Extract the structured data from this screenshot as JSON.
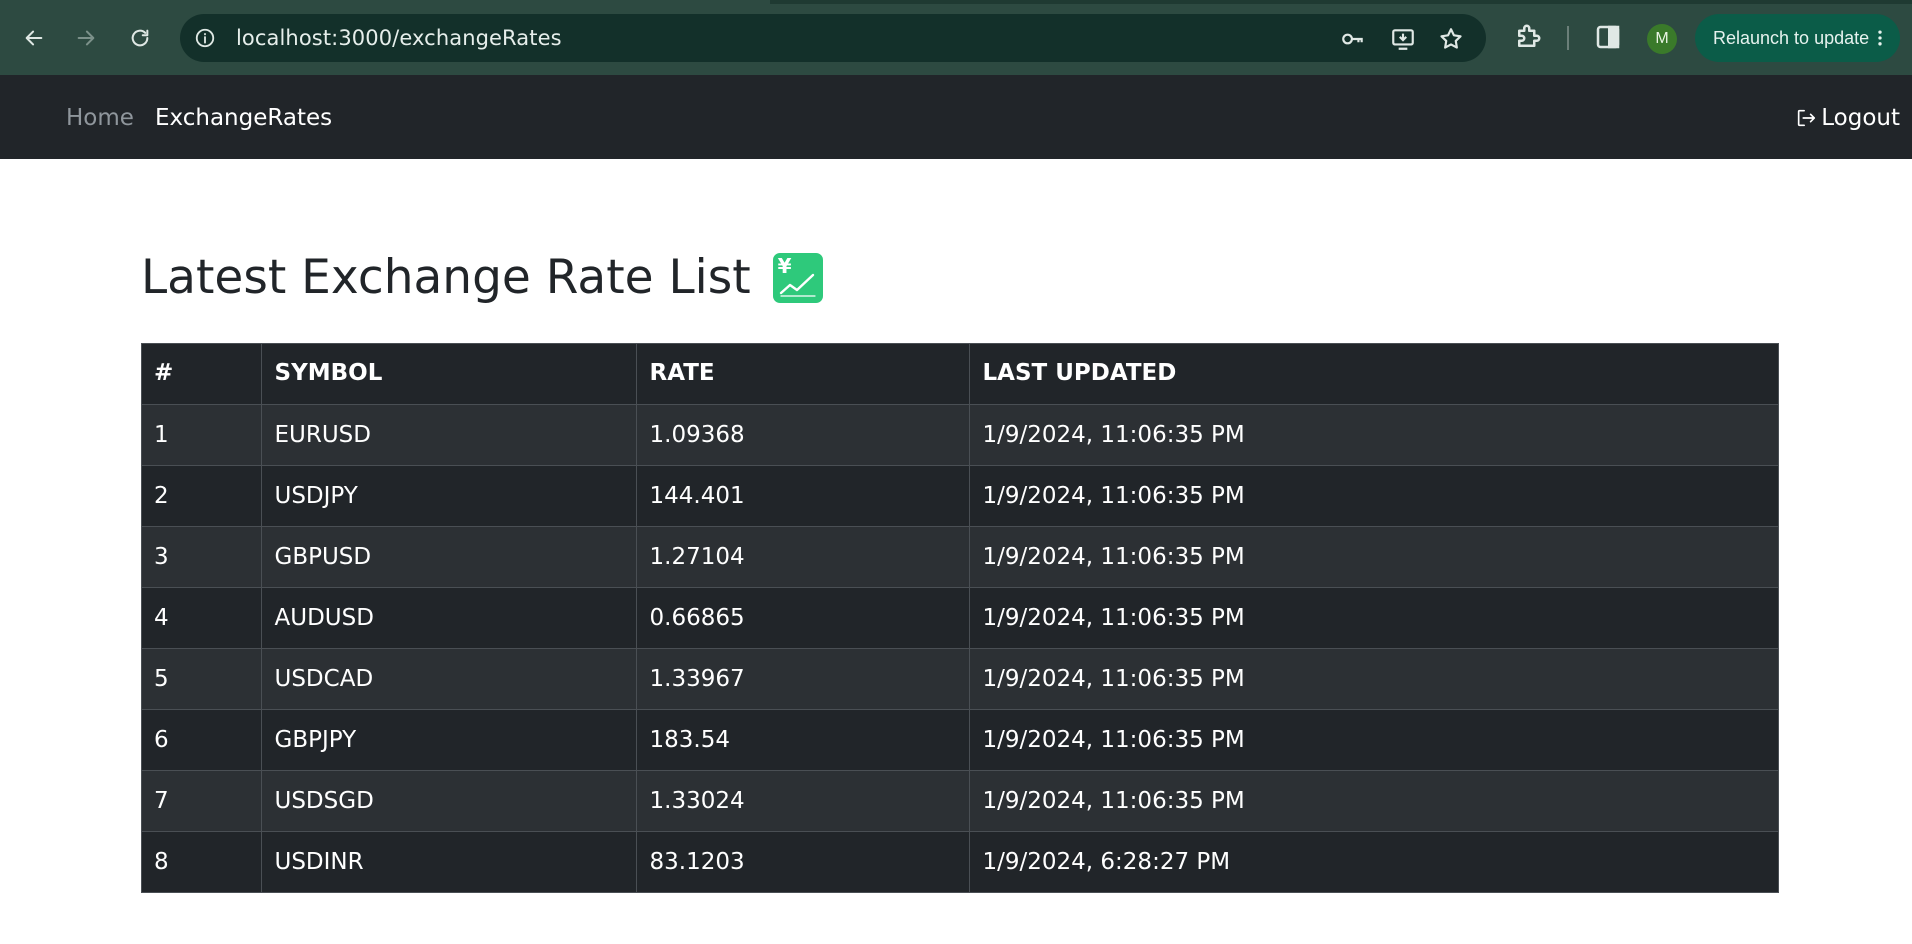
{
  "browser": {
    "url": "localhost:3000/exchangeRates",
    "profile_initial": "M",
    "relaunch_label": "Relaunch to update"
  },
  "navbar": {
    "home_label": "Home",
    "rates_label": "ExchangeRates",
    "logout_label": "Logout"
  },
  "main": {
    "title": "Latest Exchange Rate List",
    "title_emoji": "💹",
    "table": {
      "headers": [
        "#",
        "SYMBOL",
        "RATE",
        "LAST UPDATED"
      ],
      "rows": [
        {
          "num": "1",
          "symbol": "EURUSD",
          "rate": "1.09368",
          "updated": "1/9/2024, 11:06:35 PM"
        },
        {
          "num": "2",
          "symbol": "USDJPY",
          "rate": "144.401",
          "updated": "1/9/2024, 11:06:35 PM"
        },
        {
          "num": "3",
          "symbol": "GBPUSD",
          "rate": "1.27104",
          "updated": "1/9/2024, 11:06:35 PM"
        },
        {
          "num": "4",
          "symbol": "AUDUSD",
          "rate": "0.66865",
          "updated": "1/9/2024, 11:06:35 PM"
        },
        {
          "num": "5",
          "symbol": "USDCAD",
          "rate": "1.33967",
          "updated": "1/9/2024, 11:06:35 PM"
        },
        {
          "num": "6",
          "symbol": "GBPJPY",
          "rate": "183.54",
          "updated": "1/9/2024, 11:06:35 PM"
        },
        {
          "num": "7",
          "symbol": "USDSGD",
          "rate": "1.33024",
          "updated": "1/9/2024, 11:06:35 PM"
        },
        {
          "num": "8",
          "symbol": "USDINR",
          "rate": "83.1203",
          "updated": "1/9/2024, 6:28:27 PM"
        }
      ]
    }
  }
}
